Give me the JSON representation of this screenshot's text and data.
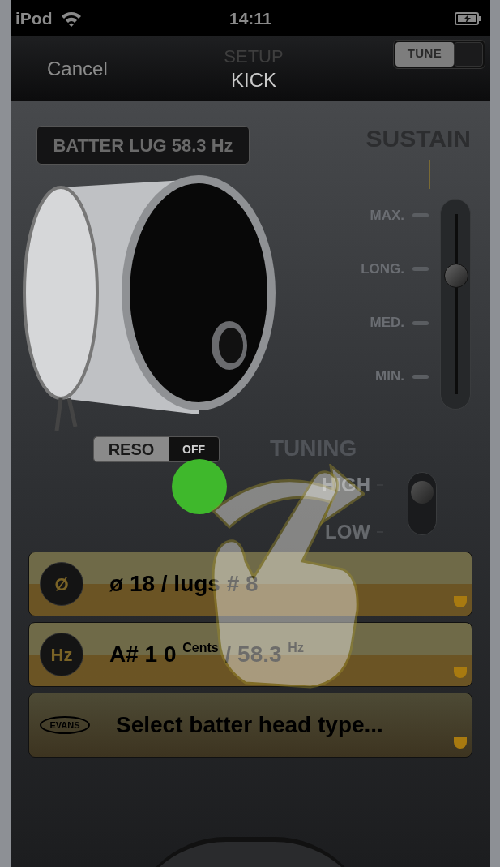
{
  "status_bar": {
    "carrier": "iPod",
    "time": "14:11"
  },
  "nav_bar": {
    "cancel": "Cancel",
    "title": "SETUP",
    "subtitle": "KICK",
    "tune_toggle": {
      "label": "TUNE",
      "on": false
    }
  },
  "lug_display": "BATTER LUG 58.3 Hz",
  "sustain": {
    "title": "SUSTAIN",
    "marks": [
      "MAX.",
      "LONG.",
      "MED.",
      "MIN."
    ],
    "level": 0.67
  },
  "reso_switch": {
    "label": "RESO",
    "state": "OFF",
    "on": false
  },
  "tuning": {
    "title": "TUNING",
    "options": [
      {
        "label": "HIGH",
        "selected": true
      },
      {
        "label": "LOW",
        "selected": false
      }
    ]
  },
  "rows": [
    {
      "kind": "glyph",
      "icon_text": "Ø",
      "text": "ø 18 / lugs # 8"
    },
    {
      "kind": "pitch",
      "icon_text": "Hz",
      "note": "A# 1 0",
      "cents_label": "Cents",
      "separator": "/",
      "frequency": "58.3",
      "unit": "Hz"
    },
    {
      "kind": "logo",
      "icon_text": "EVANS",
      "text": "Select batter head type..."
    }
  ]
}
